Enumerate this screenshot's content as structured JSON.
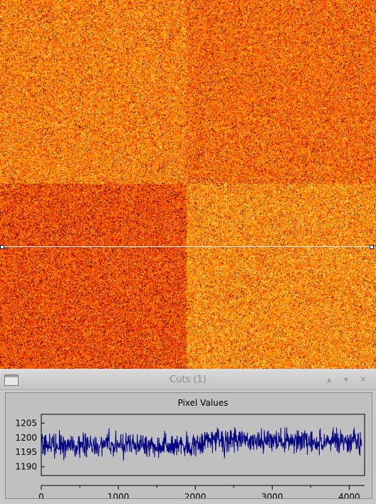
{
  "window": {
    "title": "Cuts (1)",
    "menu_icon": "window-menu-icon",
    "up_icon": "triangle-up-icon",
    "down_icon": "triangle-down-icon",
    "close_icon": "close-icon"
  },
  "image": {
    "colormap": "heat",
    "quadrants": [
      "upper-left bright",
      "upper-right medium",
      "lower-left dark",
      "lower-right light"
    ]
  },
  "chart_data": {
    "type": "line",
    "title": "Pixel Values",
    "xlabel": "",
    "ylabel": "",
    "xlim": [
      0,
      4200
    ],
    "ylim": [
      1187,
      1208
    ],
    "x_ticks": [
      0,
      1000,
      2000,
      3000,
      4000
    ],
    "y_ticks": [
      1190,
      1195,
      1200,
      1205
    ],
    "line_color": "#000080",
    "series": [
      {
        "segments": [
          {
            "x_start": 0,
            "x_end": 2080,
            "mean": 1197.5,
            "spread": 2.2
          },
          {
            "x_start": 2080,
            "x_end": 4160,
            "mean": 1199.0,
            "spread": 2.2
          }
        ]
      }
    ]
  }
}
